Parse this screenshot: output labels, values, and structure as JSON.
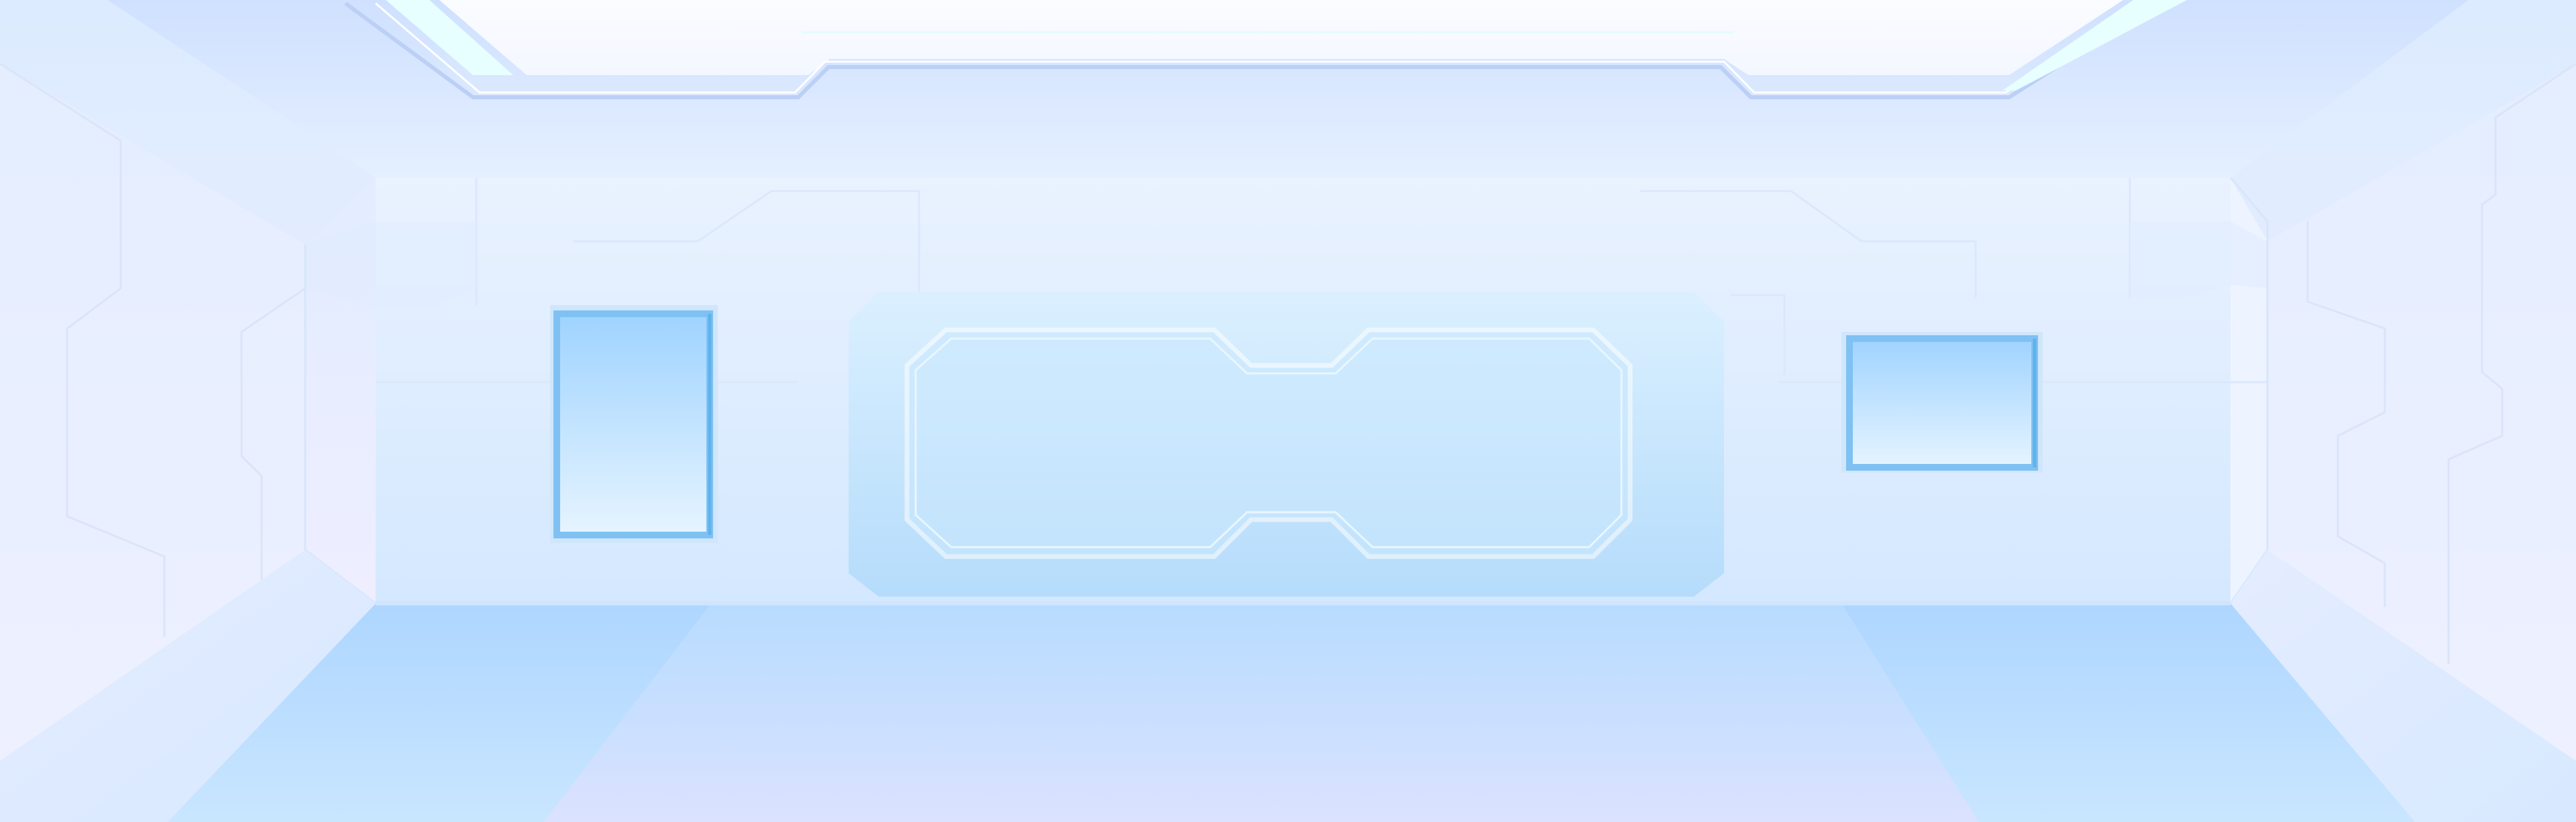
{
  "scene": {
    "kind": "sci-fi corridor interior",
    "text_labels": []
  },
  "palette": {
    "outline": "#ffffff",
    "panel_blue": "#9fd2ff",
    "panel_blue_light": "#dff0ff",
    "panel_frame": "#7fc1f3",
    "ceiling_blue": "#cfe3ff",
    "floor_blue": "#b9ddff",
    "floor_lavender": "#dfe4ff",
    "wall_light": "#eef4ff",
    "wall_pink": "#f1ecff",
    "accent_cyan": "#e8ffff",
    "accent_edge": "#b8cdf6"
  }
}
